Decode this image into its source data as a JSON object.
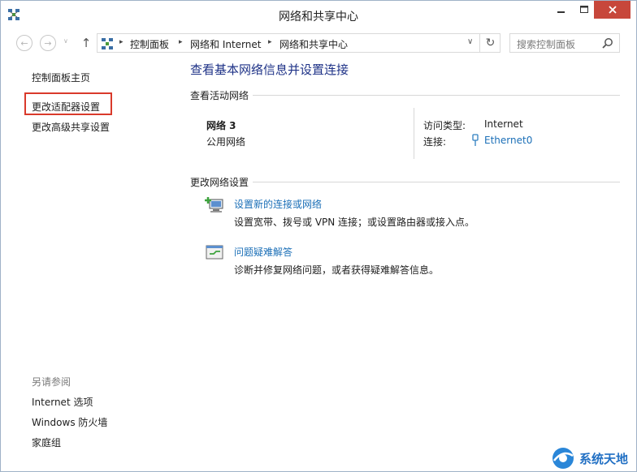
{
  "window": {
    "title": "网络和共享中心",
    "icon": "network-center-icon",
    "buttons": [
      "minimize-icon",
      "maximize-icon",
      "close-icon"
    ]
  },
  "navbar": {
    "back_glyph": "←",
    "forward_glyph": "→",
    "recent_glyph": "∨",
    "up_glyph": "↑",
    "breadcrumbs": [
      "控制面板",
      "网络和 Internet",
      "网络和共享中心"
    ],
    "separator": "▸",
    "dropdown_glyph": "∨",
    "refresh_glyph": "↻",
    "search_placeholder": "搜索控制面板"
  },
  "sidebar": {
    "items": [
      "控制面板主页",
      "更改适配器设置",
      "更改高级共享设置"
    ],
    "highlighted_item": "更改适配器设置",
    "highlight_color": "#d93a2b",
    "see_also_title": "另请参阅",
    "see_also": [
      "Internet 选项",
      "Windows 防火墙",
      "家庭组"
    ]
  },
  "main": {
    "title": "查看基本网络信息并设置连接",
    "active_networks_heading": "查看活动网络",
    "network": {
      "name": "网络  3",
      "type": "公用网络",
      "access_label": "访问类型:",
      "access_value": "Internet",
      "connection_label": "连接:",
      "connection_value": "Ethernet0"
    },
    "change_heading": "更改网络设置",
    "tasks": [
      {
        "link": "设置新的连接或网络",
        "desc": "设置宽带、拨号或 VPN 连接；或设置路由器或接入点。",
        "icon": "new-connection-icon"
      },
      {
        "link": "问题疑难解答",
        "desc": "诊断并修复网络问题，或者获得疑难解答信息。",
        "icon": "troubleshoot-icon"
      }
    ],
    "link_color": "#1b6fb7",
    "title_color": "#1e3287"
  },
  "watermark": {
    "text": "系统天地"
  }
}
